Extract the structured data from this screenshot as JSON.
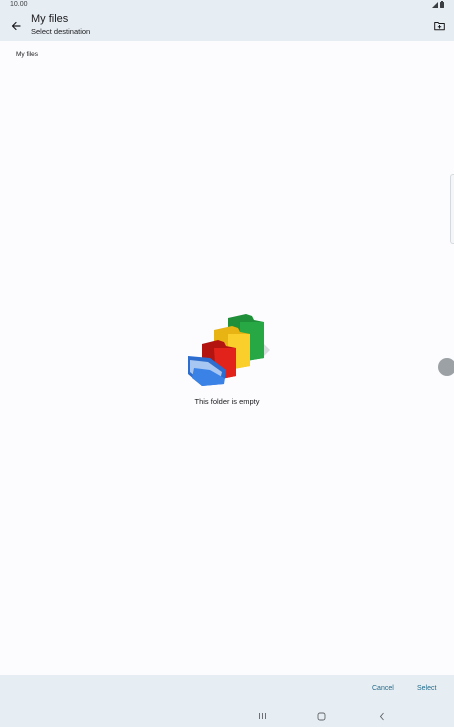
{
  "status_bar": {
    "time": "10.00",
    "signal_icon": "signal-icon",
    "battery_icon": "battery-icon"
  },
  "app_bar": {
    "title": "My files",
    "subtitle": "Select destination",
    "back_icon": "arrow-left-icon",
    "new_folder_icon": "folder-add-icon"
  },
  "breadcrumb": {
    "current": "My files"
  },
  "empty_state": {
    "message": "This folder is empty",
    "illustration": "empty-folders-illustration"
  },
  "actions": {
    "cancel_label": "Cancel",
    "select_label": "Select"
  },
  "navigation": {
    "recents_icon": "recents-icon",
    "home_icon": "home-icon",
    "back_icon": "back-chevron-icon"
  },
  "colors": {
    "bar_background": "#e7eef3",
    "accent": "#1f6a8a",
    "page_background": "#fcfcfe"
  }
}
